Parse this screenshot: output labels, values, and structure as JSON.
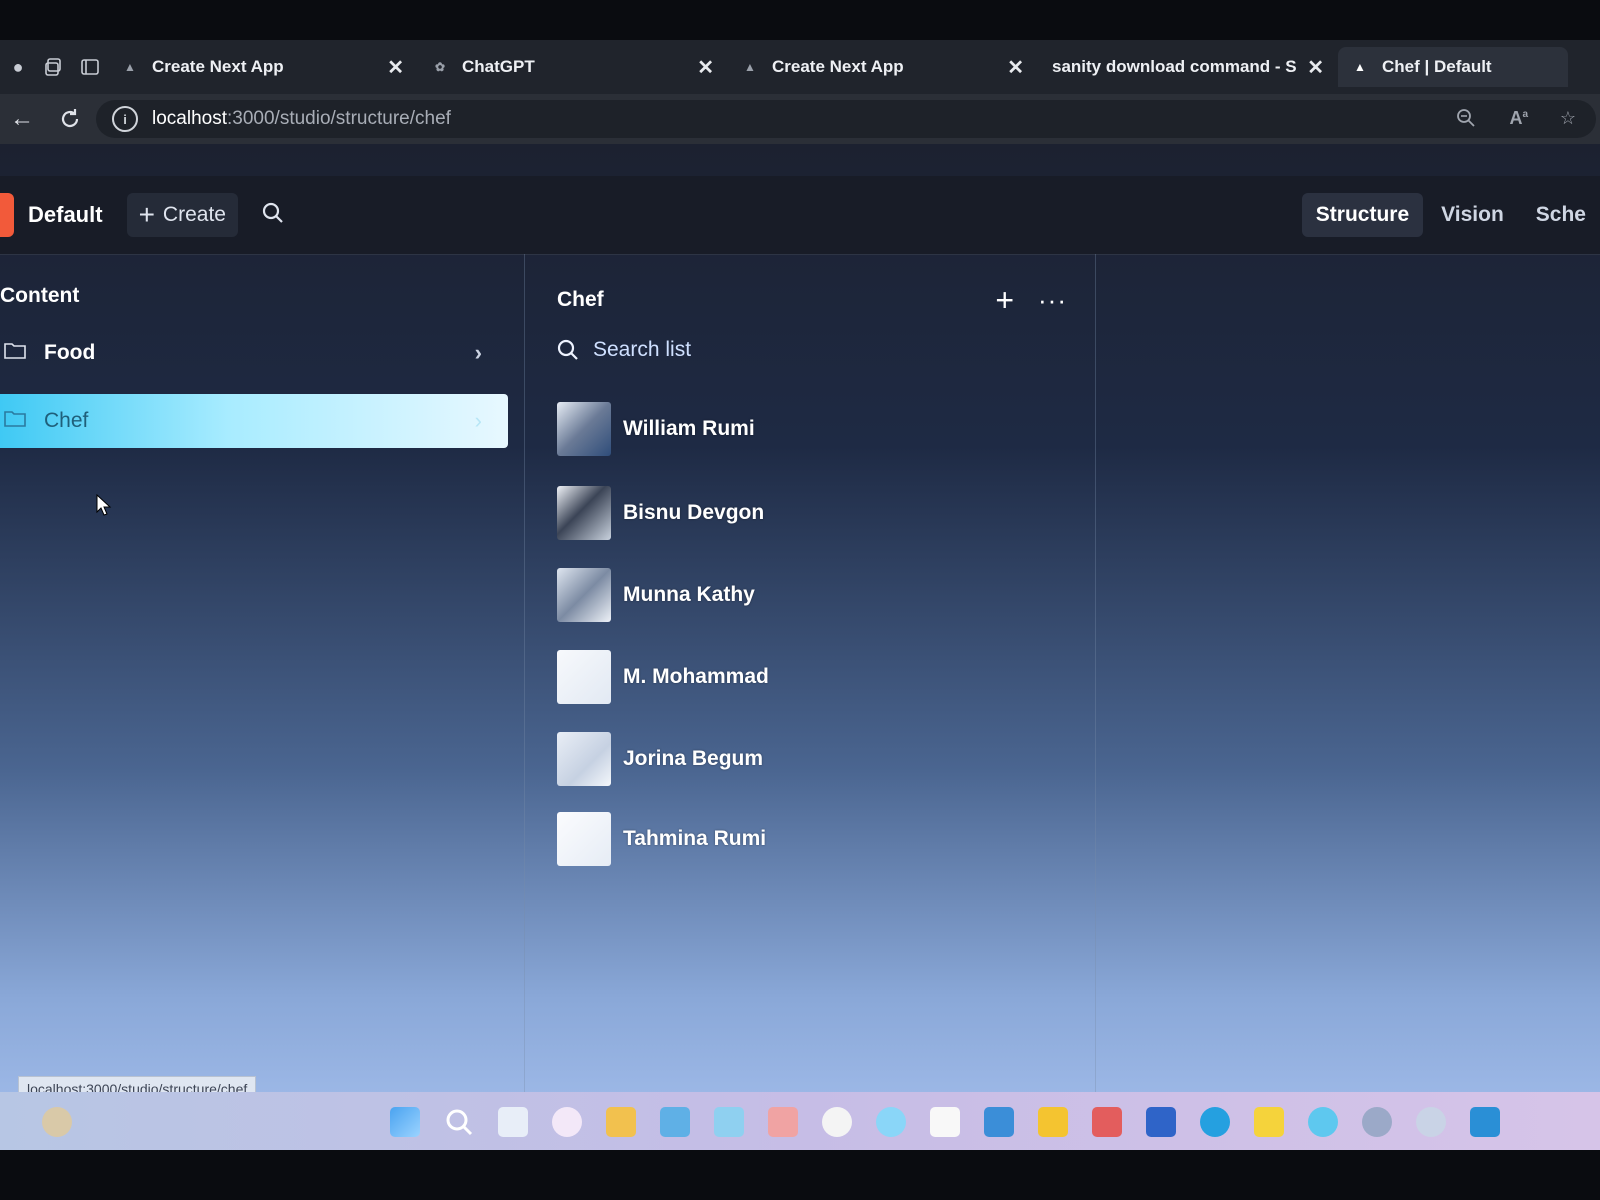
{
  "browser": {
    "tabs": [
      {
        "title": "Create Next App",
        "close": "✕"
      },
      {
        "title": "ChatGPT",
        "close": "✕"
      },
      {
        "title": "Create Next App",
        "close": "✕"
      },
      {
        "title": "sanity download command - Se",
        "close": "✕"
      },
      {
        "title": "Chef | Default",
        "close": ""
      }
    ],
    "url_host": "localhost",
    "url_path": ":3000/studio/structure/chef"
  },
  "studio": {
    "workspace": "Default",
    "create_label": "Create",
    "top_tabs": [
      "Structure",
      "Vision",
      "Sche"
    ],
    "active_tab": "Structure"
  },
  "content_pane": {
    "title": "Content",
    "items": [
      {
        "label": "Food",
        "chevron": "›"
      },
      {
        "label": "Chef",
        "chevron": "›"
      }
    ],
    "selected": "Chef"
  },
  "chef_pane": {
    "title": "Chef",
    "search_placeholder": "Search list",
    "chefs": [
      {
        "name": "William Rumi"
      },
      {
        "name": "Bisnu Devgon"
      },
      {
        "name": "Munna Kathy"
      },
      {
        "name": "M. Mohammad"
      },
      {
        "name": "Jorina Begum"
      },
      {
        "name": "Tahmina Rumi"
      }
    ]
  },
  "status_bar": {
    "url": "localhost:3000/studio/structure/chef"
  },
  "colors": {
    "accent": "#3fc9f4",
    "logo": "#f25a3a",
    "panel_bg": "#1c2130"
  }
}
